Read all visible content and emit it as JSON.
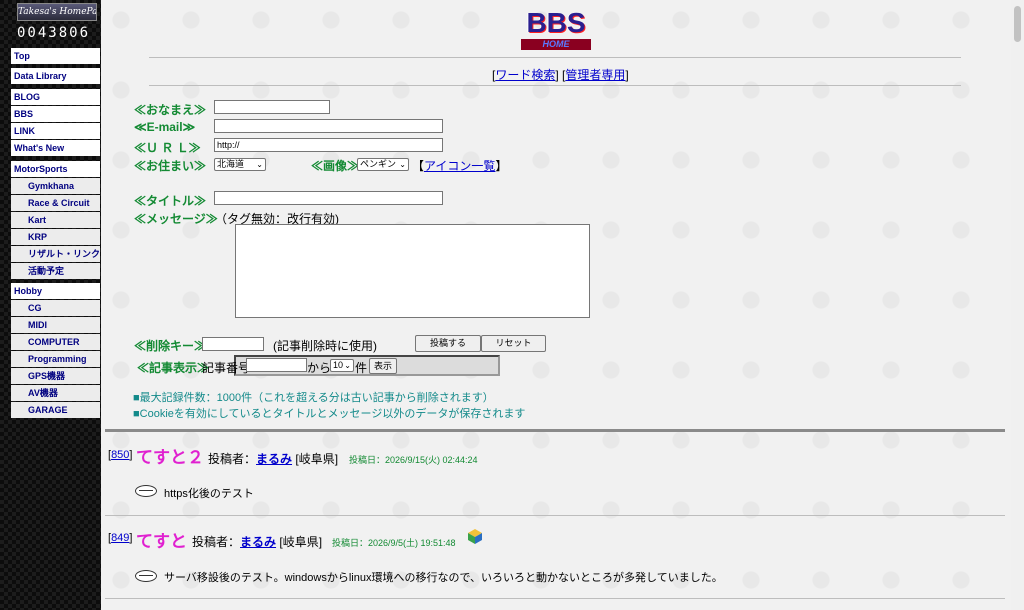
{
  "site": {
    "logo_text": "Takesa's HomePage",
    "counter": "0043806"
  },
  "sidebar": {
    "items": [
      {
        "label": "Top"
      },
      {
        "label": "Data Library"
      },
      {
        "label": "BLOG"
      },
      {
        "label": "BBS"
      },
      {
        "label": "LINK"
      },
      {
        "label": "What's New"
      },
      {
        "label": "MotorSports"
      },
      {
        "label": "Gymkhana"
      },
      {
        "label": "Race & Circuit"
      },
      {
        "label": "Kart"
      },
      {
        "label": "KRP"
      },
      {
        "label": "リザルト・リンク"
      },
      {
        "label": "活動予定"
      },
      {
        "label": "Hobby"
      },
      {
        "label": "CG"
      },
      {
        "label": "MIDI"
      },
      {
        "label": "COMPUTER"
      },
      {
        "label": "Programming"
      },
      {
        "label": "GPS機器"
      },
      {
        "label": "AV機器"
      },
      {
        "label": "GARAGE"
      }
    ]
  },
  "header": {
    "bbs_title": "BBS",
    "bbs_subtitle": "HOME",
    "word_search": "ワード検索",
    "admin": "管理者専用"
  },
  "form": {
    "name_label": "≪おなまえ≫",
    "email_label": "≪E-mail≫",
    "url_label": "≪Ｕ Ｒ Ｌ≫",
    "url_value": "http://",
    "address_label": "≪お住まい≫",
    "address_value": "北海道",
    "image_label": "≪画像≫",
    "image_value": "ペンギン",
    "icon_list": "アイコン一覧",
    "title_label": "≪タイトル≫",
    "message_label": "≪メッセージ≫",
    "message_note": "（タグ無効：改行有効)",
    "delkey_label": "≪削除キー≫",
    "delkey_note": "(記事削除時に使用)",
    "submit": "投稿する",
    "reset": "リセット",
    "display_label": "≪記事表示≫",
    "article_no": "記事番号",
    "from": "から",
    "count_value": "10",
    "count_unit": "件",
    "show": "表示"
  },
  "notes": [
    "■最大記録件数：1000件（これを超える分は古い記事から削除されます）",
    "■Cookieを有効にしているとタイトルとメッセージ以外のデータが保存されます"
  ],
  "posts": [
    {
      "num": "850",
      "title": "てすと２",
      "author_label": "投稿者：",
      "author": "まるみ",
      "location": "[岐阜県]",
      "date": "投稿日：2026/9/15(火) 02:44:24",
      "body": "https化後のテスト"
    },
    {
      "num": "849",
      "title": "てすと",
      "author_label": "投稿者：",
      "author": "まるみ",
      "location": "[岐阜県]",
      "date": "投稿日：2026/9/5(土) 19:51:48",
      "body": "サーバ移設後のテスト。windowsからlinux環境への移行なので、いろいろと動かないところが多発していました。"
    }
  ]
}
